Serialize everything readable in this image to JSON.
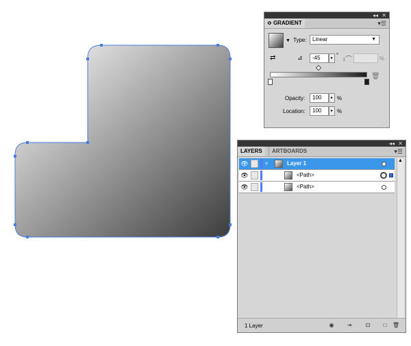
{
  "gradient_panel": {
    "title": "GRADIENT",
    "title_prefix": "≎",
    "type_label": "Type:",
    "type_value": "Linear",
    "angle_value": "-45",
    "angle_unit": "°",
    "aspect_unit": "%",
    "opacity_label": "Opacity:",
    "opacity_value": "100",
    "opacity_unit": "%",
    "location_label": "Location:",
    "location_value": "100",
    "location_unit": "%",
    "menu_icon": "menu-lines-icon",
    "start_stop_color": "#ffffff",
    "end_stop_color": "#1c1c1c"
  },
  "layers_panel": {
    "tabs": [
      {
        "label": "LAYERS"
      },
      {
        "label": "ARTBOARDS"
      }
    ],
    "rows": [
      {
        "label": "Layer 1",
        "selected": true
      },
      {
        "label": "<Path>",
        "selected": false
      },
      {
        "label": "<Path>",
        "selected": false
      }
    ],
    "footer_label": "1 Layer",
    "layer_color": "#4f7bff",
    "selection_color": "#3a96e8"
  },
  "artwork": {
    "gradient_start": "#ffffff",
    "gradient_end": "#3d3d3d",
    "path_stroke_color": "#4a7bdc"
  }
}
